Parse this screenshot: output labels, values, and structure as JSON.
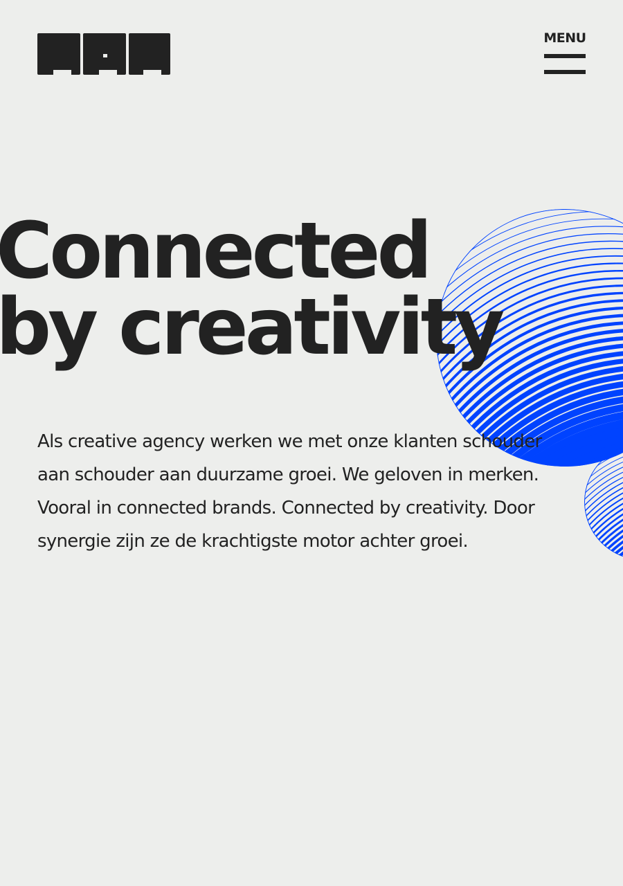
{
  "header": {
    "logo_icon": "brand-logo",
    "menu_label": "MENU",
    "menu_icon": "hamburger-icon"
  },
  "hero": {
    "title_line_1": "Connected",
    "title_line_2": "by creativity",
    "intro_text": "Als creative agency werken we met onze klanten schouder aan schouder aan duurzame groei. We geloven in merken. Vooral in connected brands. Connected by creativity. Door synergie zijn ze de krachtigste motor achter groei.",
    "graphic": "striped-spheres-graphic"
  },
  "colors": {
    "background": "#edeeec",
    "text": "#222222",
    "accent": "#0043ff"
  }
}
